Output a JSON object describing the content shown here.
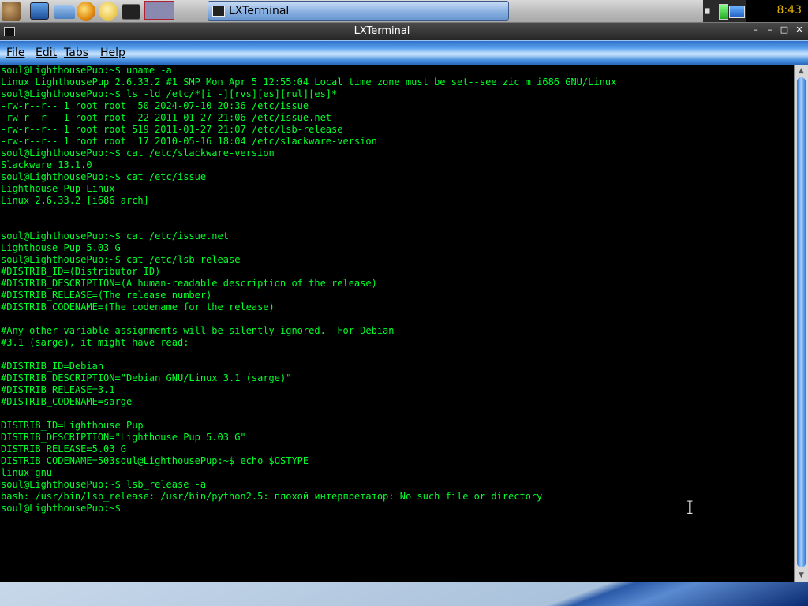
{
  "panel": {
    "launchers": [
      "menu-icon",
      "desktop-icon",
      "folder-icon",
      "browser-icon",
      "chat-icon",
      "terminal-icon"
    ],
    "taskbar_button": "LXTerminal",
    "clock": "8:43"
  },
  "window": {
    "title": "LXTerminal",
    "menu": {
      "file": "File",
      "edit": "Edit",
      "tabs": "Tabs",
      "help": "Help"
    }
  },
  "terminal": {
    "lines": [
      "soul@LighthousePup:~$ uname -a",
      "Linux LighthousePup 2.6.33.2 #1 SMP Mon Apr 5 12:55:04 Local time zone must be set--see zic m i686 GNU/Linux",
      "soul@LighthousePup:~$ ls -ld /etc/*[i_-][rvs][es][rul][es]*",
      "-rw-r--r-- 1 root root  50 2024-07-10 20:36 /etc/issue",
      "-rw-r--r-- 1 root root  22 2011-01-27 21:06 /etc/issue.net",
      "-rw-r--r-- 1 root root 519 2011-01-27 21:07 /etc/lsb-release",
      "-rw-r--r-- 1 root root  17 2010-05-16 18:04 /etc/slackware-version",
      "soul@LighthousePup:~$ cat /etc/slackware-version",
      "Slackware 13.1.0",
      "soul@LighthousePup:~$ cat /etc/issue",
      "Lighthouse Pup Linux",
      "Linux 2.6.33.2 [i686 arch]",
      "",
      "",
      "soul@LighthousePup:~$ cat /etc/issue.net",
      "Lighthouse Pup 5.03 G",
      "soul@LighthousePup:~$ cat /etc/lsb-release",
      "#DISTRIB_ID=(Distributor ID)",
      "#DISTRIB_DESCRIPTION=(A human-readable description of the release)",
      "#DISTRIB_RELEASE=(The release number)",
      "#DISTRIB_CODENAME=(The codename for the release)",
      "",
      "#Any other variable assignments will be silently ignored.  For Debian",
      "#3.1 (sarge), it might have read:",
      "",
      "#DISTRIB_ID=Debian",
      "#DISTRIB_DESCRIPTION=\"Debian GNU/Linux 3.1 (sarge)\"",
      "#DISTRIB_RELEASE=3.1",
      "#DISTRIB_CODENAME=sarge",
      "",
      "DISTRIB_ID=Lighthouse Pup",
      "DISTRIB_DESCRIPTION=\"Lighthouse Pup 5.03 G\"",
      "DISTRIB_RELEASE=5.03 G",
      "DISTRIB_CODENAME=503soul@LighthousePup:~$ echo $OSTYPE",
      "linux-gnu",
      "soul@LighthousePup:~$ lsb_release -a",
      "bash: /usr/bin/lsb_release: /usr/bin/python2.5: плохой интерпретатор: No such file or directory",
      "soul@LighthousePup:~$ "
    ],
    "text_color": "#00ff2a",
    "background": "#000000"
  },
  "cursor": "I"
}
